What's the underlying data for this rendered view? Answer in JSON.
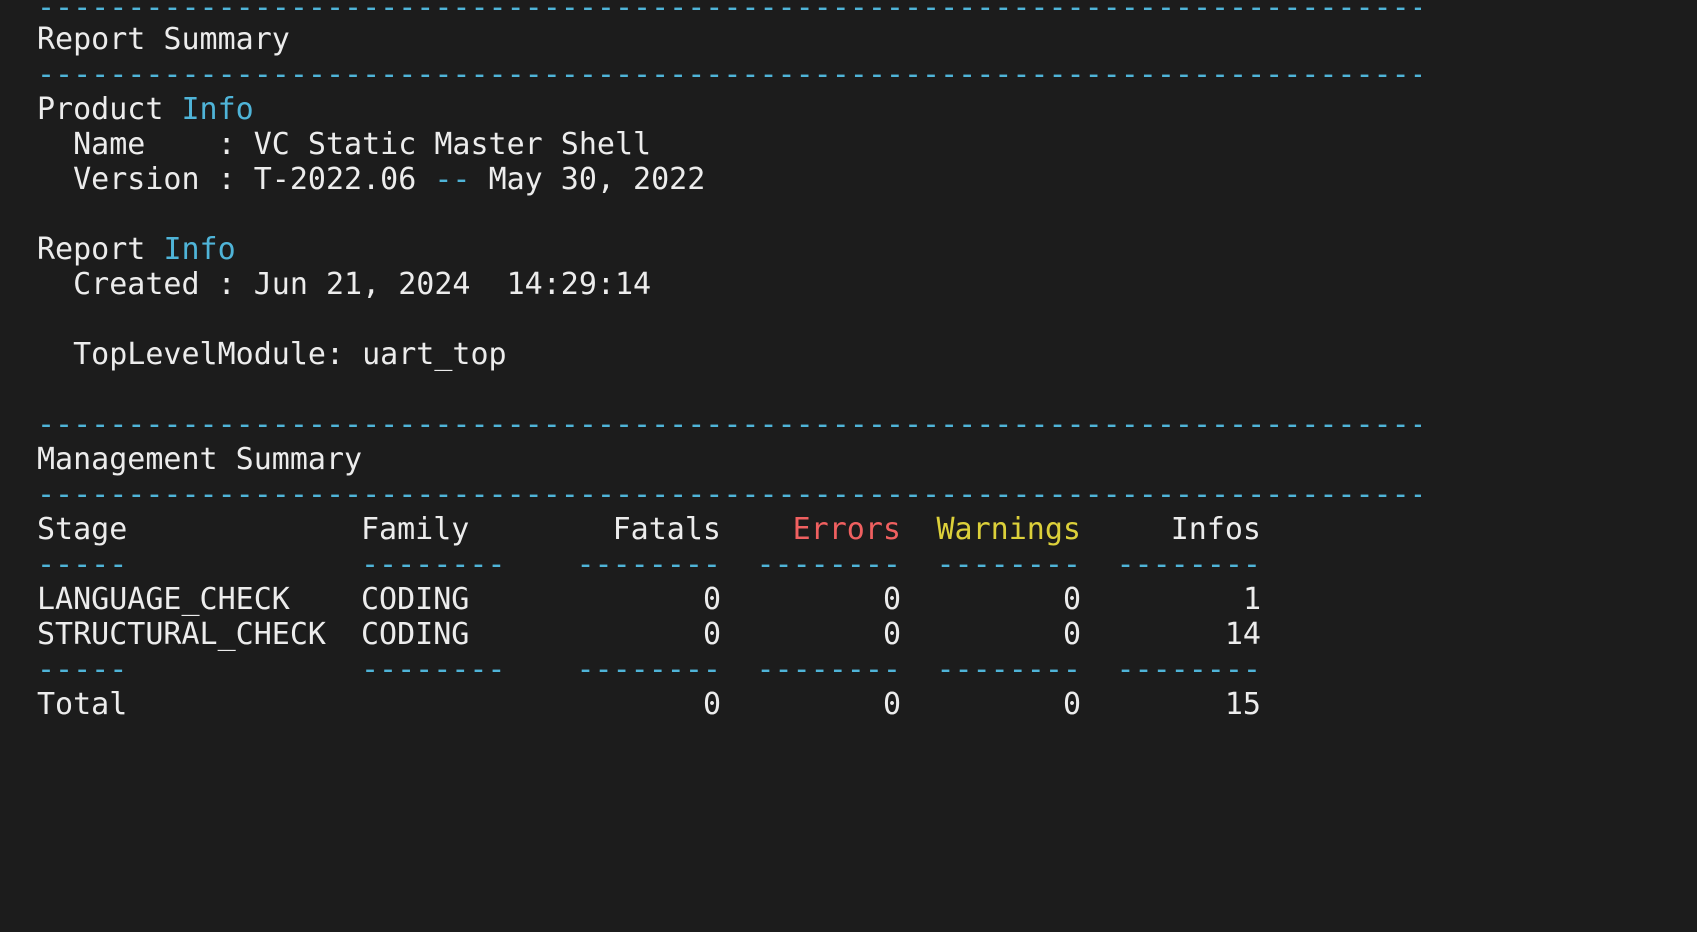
{
  "rule_chars": "--------------------------------------------------------------------------------",
  "report_summary": {
    "title": "Report Summary"
  },
  "product_info": {
    "heading_word": "Product",
    "heading_accent": "Info",
    "name_label": "  Name    : ",
    "name_value": "VC Static Master Shell",
    "version_label": "  Version : ",
    "version_value": "T-2022.06",
    "version_sep": " -- ",
    "version_date": "May 30, 2022"
  },
  "report_info": {
    "heading_word": "Report",
    "heading_accent": "Info",
    "created_label": "  Created : ",
    "created_value": "Jun 21, 2024  14:29:14",
    "top_module_label": "  TopLevelModule: ",
    "top_module_value": "uart_top"
  },
  "management_summary": {
    "title": "Management Summary",
    "columns": {
      "stage": "Stage",
      "family": "Family",
      "fatals": "Fatals",
      "errors": "Errors",
      "warnings": "Warnings",
      "infos": "Infos"
    },
    "separators": {
      "short": "-----",
      "long": "--------"
    },
    "rows": [
      {
        "stage": "LANGUAGE_CHECK",
        "family": "CODING",
        "fatals": "0",
        "errors": "0",
        "warnings": "0",
        "infos": "1"
      },
      {
        "stage": "STRUCTURAL_CHECK",
        "family": "CODING",
        "fatals": "0",
        "errors": "0",
        "warnings": "0",
        "infos": "14"
      }
    ],
    "total": {
      "stage": "Total",
      "fatals": "0",
      "errors": "0",
      "warnings": "0",
      "infos": "15"
    }
  },
  "colors": {
    "background": "#1c1c1c",
    "text": "#ececec",
    "accent": "#4fb4d8",
    "errors": "#f06060",
    "warnings": "#dcd03a"
  }
}
